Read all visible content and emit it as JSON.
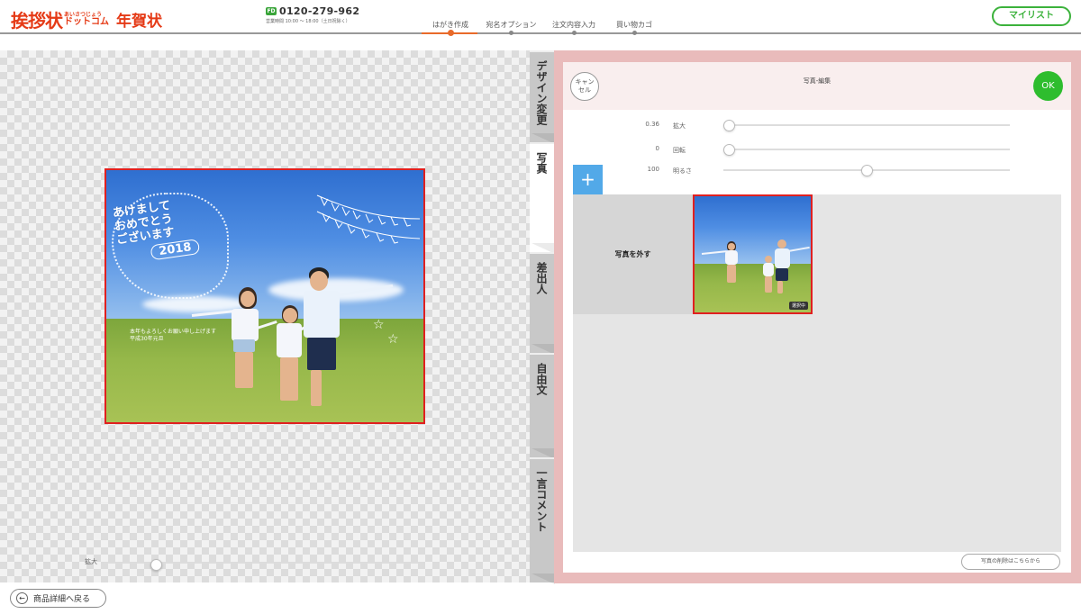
{
  "header": {
    "logo": {
      "main": "挨拶状",
      "kana": "あいさつじょう",
      "dotcom": "ドットコム",
      "suffix": "年賀状"
    },
    "phone": {
      "number": "0120-279-962",
      "hours": "営業時間 10:00 〜 18:00（土日祝除く）",
      "icon": "free-dial-icon"
    },
    "steps": [
      {
        "label": "はがき作成",
        "active": true
      },
      {
        "label": "宛名オプション",
        "active": false
      },
      {
        "label": "注文内容入力",
        "active": false
      },
      {
        "label": "買い物カゴ",
        "active": false
      }
    ],
    "mylist_label": "マイリスト"
  },
  "card": {
    "greeting_lines": [
      "あけまして",
      "おめでとう",
      "ございます"
    ],
    "year": "2018",
    "message": [
      "本年もよろしくお願い申し上げます",
      "平成30年元旦"
    ]
  },
  "canvas": {
    "zoom_label": "拡大",
    "zoom_level": 0.15
  },
  "tabs": [
    {
      "label": "デザイン変更",
      "active": false
    },
    {
      "label": "写真",
      "active": true
    },
    {
      "label": "差出人",
      "active": false
    },
    {
      "label": "自由文",
      "active": false
    },
    {
      "label": "一言コメント",
      "active": false
    }
  ],
  "editor": {
    "title": "写真-編集",
    "cancel_label": "キャンセル",
    "ok_label": "OK",
    "controls": [
      {
        "value": "0.36",
        "label": "拡大",
        "level": 0.0
      },
      {
        "value": "0",
        "label": "回転",
        "level": 0.0
      },
      {
        "value": "100",
        "label": "明るさ",
        "level": 0.5
      }
    ],
    "add_icon": "plus-icon",
    "remove_photo_label": "写真を外す",
    "selected_badge": "選択中",
    "delete_link": "写真の削除はこちらから"
  },
  "footer": {
    "back_label": "商品詳細へ戻る",
    "back_icon": "arrow-left-icon"
  },
  "colors": {
    "brand": "#e53a16",
    "accent_green": "#2ebd2e",
    "panel_pink": "#e9bbbb",
    "selection_red": "#e02020",
    "add_blue": "#52a9e8"
  }
}
